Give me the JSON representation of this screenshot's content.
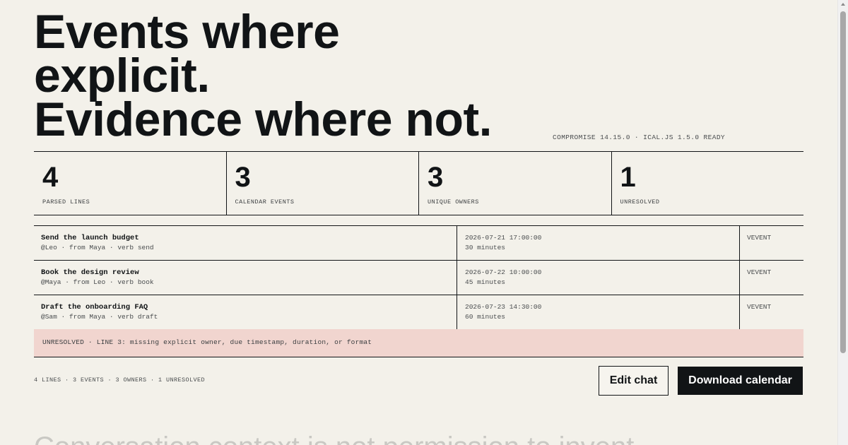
{
  "hero": {
    "line1": "Events where",
    "line2": "explicit.",
    "line3": "Evidence where not.",
    "version": "COMPROMISE 14.15.0 · ICAL.JS 1.5.0 READY"
  },
  "stats": [
    {
      "value": "4",
      "label": "PARSED LINES"
    },
    {
      "value": "3",
      "label": "CALENDAR EVENTS"
    },
    {
      "value": "3",
      "label": "UNIQUE OWNERS"
    },
    {
      "value": "1",
      "label": "UNRESOLVED"
    }
  ],
  "events": [
    {
      "title": "Send the launch budget",
      "meta": "@Leo · from Maya · verb send",
      "datetime": "2026-07-21 17:00:00",
      "duration": "30 minutes",
      "kind": "VEVENT"
    },
    {
      "title": "Book the design review",
      "meta": "@Maya · from Leo · verb book",
      "datetime": "2026-07-22 10:00:00",
      "duration": "45 minutes",
      "kind": "VEVENT"
    },
    {
      "title": "Draft the onboarding FAQ",
      "meta": "@Sam · from Maya · verb draft",
      "datetime": "2026-07-23 14:30:00",
      "duration": "60 minutes",
      "kind": "VEVENT"
    }
  ],
  "unresolved": "UNRESOLVED · LINE 3: missing explicit owner, due timestamp, duration, or format",
  "footer": {
    "summary": "4 LINES · 3 EVENTS · 3 OWNERS · 1 UNRESOLVED",
    "edit_label": "Edit chat",
    "download_label": "Download calendar"
  },
  "next_heading": "Conversation context is not permission to invent",
  "colors": {
    "background": "#f3f1ea",
    "ink": "#111416",
    "unresolved_bg": "#f1d5cf"
  }
}
